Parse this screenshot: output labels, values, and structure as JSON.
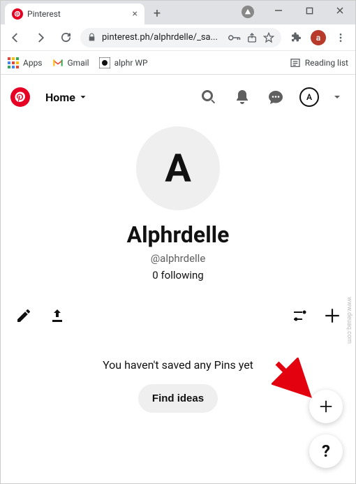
{
  "browser": {
    "tab_title": "Pinterest",
    "url_display": "pinterest.ph/alphrdelle/_sa...",
    "avatar_letter": "a",
    "bookmarks": {
      "apps": "Apps",
      "gmail": "Gmail",
      "alphr": "alphr WP",
      "reading_list": "Reading list"
    }
  },
  "nav": {
    "home_label": "Home",
    "avatar_letter": "A"
  },
  "profile": {
    "avatar_letter": "A",
    "display_name": "Alphrdelle",
    "handle": "@alphrdelle",
    "following": "0 following"
  },
  "empty": {
    "message": "You haven't saved any Pins yet",
    "button": "Find ideas"
  },
  "fab": {
    "plus": "+",
    "help": "?"
  },
  "watermark": "www.deuaq.com"
}
